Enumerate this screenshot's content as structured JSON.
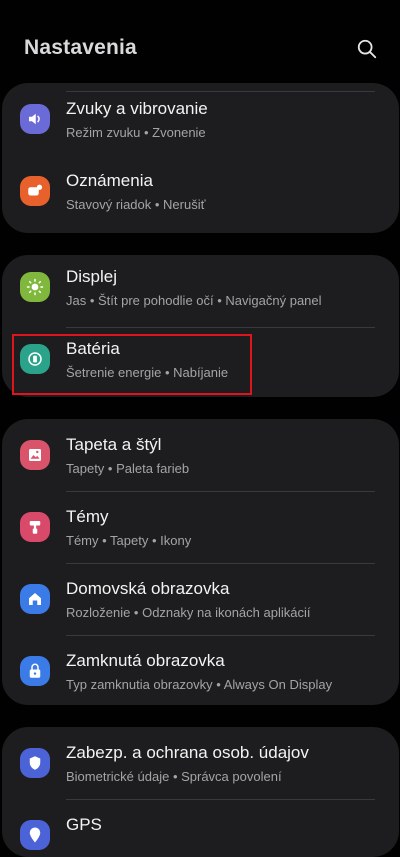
{
  "header": {
    "title": "Nastavenia",
    "search_icon": "search-icon"
  },
  "colors": {
    "background": "#010101",
    "card": "#1d1d1f",
    "highlight": "#e0141e",
    "sound": "#6b6bd8",
    "notifications": "#e8612d",
    "display": "#7fb83c",
    "battery": "#2aa38a",
    "wallpaper": "#d9546b",
    "themes": "#d94a6a",
    "home": "#3b7be8",
    "lock": "#3b7be8",
    "security": "#4b63d6"
  },
  "cards": [
    {
      "items": [
        {
          "label": "Zvuky a vibrovanie",
          "sub": "Režim zvuku  •  Zvonenie",
          "icon": "speaker-icon"
        },
        {
          "label": "Oznámenia",
          "sub": "Stavový riadok  •  Nerušiť",
          "icon": "notification-icon"
        }
      ]
    },
    {
      "items": [
        {
          "label": "Displej",
          "sub": "Jas  •  Štít pre pohodlie očí  •  Navigačný panel",
          "icon": "sun-icon"
        },
        {
          "label": "Batéria",
          "sub": "Šetrenie energie  •  Nabíjanie",
          "icon": "battery-icon"
        }
      ]
    },
    {
      "items": [
        {
          "label": "Tapeta a štýl",
          "sub": "Tapety  •  Paleta farieb",
          "icon": "wallpaper-icon"
        },
        {
          "label": "Témy",
          "sub": "Témy  •  Tapety  •  Ikony",
          "icon": "themes-icon"
        },
        {
          "label": "Domovská obrazovka",
          "sub": "Rozloženie  •  Odznaky na ikonách aplikácií",
          "icon": "home-icon"
        },
        {
          "label": "Zamknutá obrazovka",
          "sub": "Typ zamknutia obrazovky  •  Always On Display",
          "icon": "lock-icon"
        }
      ]
    },
    {
      "items": [
        {
          "label": "Zabezp. a ochrana osob. údajov",
          "sub": "Biometrické údaje  •  Správca povolení",
          "icon": "shield-icon"
        },
        {
          "label": "GPS",
          "sub": "",
          "icon": "location-icon"
        }
      ]
    }
  ]
}
